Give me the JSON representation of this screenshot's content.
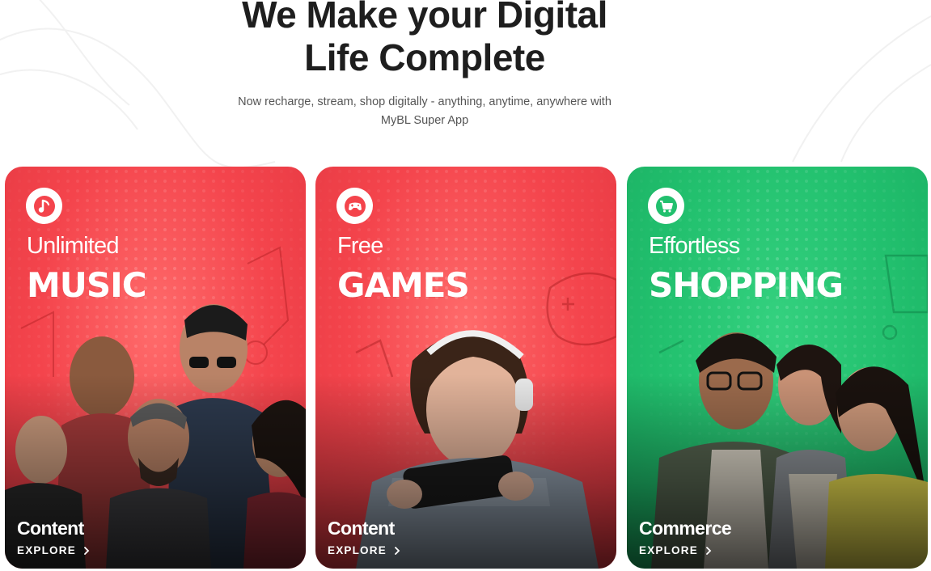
{
  "hero": {
    "title_line1": "We Make your Digital",
    "title_line2": "Life Complete",
    "subtitle_line1": "Now recharge, stream, shop digitally - anything, anytime, anywhere with",
    "subtitle_line2": "MyBL Super App"
  },
  "cards": [
    {
      "kicker": "Unlimited",
      "headline": "MUSIC",
      "category": "Content",
      "explore": "EXPLORE",
      "icon": "music-icon",
      "color": "#f4444c"
    },
    {
      "kicker": "Free",
      "headline": "GAMES",
      "category": "Content",
      "explore": "EXPLORE",
      "icon": "gamepad-icon",
      "color": "#f4444c"
    },
    {
      "kicker": "Effortless",
      "headline": "SHOPPING",
      "category": "Commerce",
      "explore": "EXPLORE",
      "icon": "shopping-cart-icon",
      "color": "#22c06e"
    }
  ]
}
